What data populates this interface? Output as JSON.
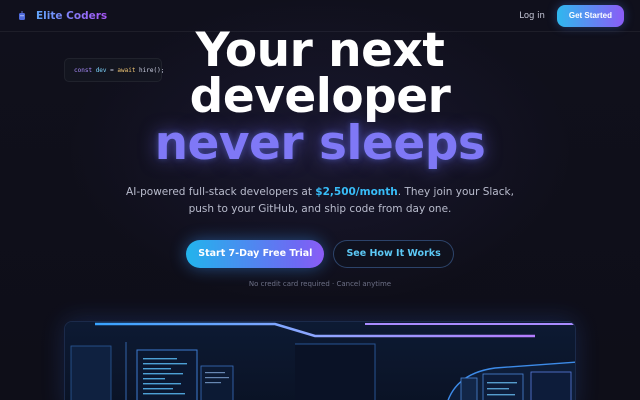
{
  "nav": {
    "brand_name": "Elite Coders",
    "login_label": "Log in",
    "cta_label": "Get Started"
  },
  "code_snippet": {
    "keyword": "const",
    "variable": "dev",
    "operator": " = ",
    "await_kw": "await",
    "call": " hire();"
  },
  "hero": {
    "line1": "Your next",
    "line2": "developer",
    "line3": "never sleeps",
    "subtitle_pre": "AI-powered full-stack developers at ",
    "subtitle_price": "$2,500/month",
    "subtitle_post": ". They join your Slack, push to your GitHub, and ship code from day one.",
    "primary_cta": "Start 7-Day Free Trial",
    "secondary_cta": "See How It Works",
    "note": "No credit card required · Cancel anytime"
  },
  "colors": {
    "background": "#0f0f1a",
    "accent_blue": "#38bdf8",
    "accent_purple": "#8b5cf6",
    "gradient_text": "#7f78f6"
  },
  "icons": {
    "brand": "robot-icon"
  }
}
